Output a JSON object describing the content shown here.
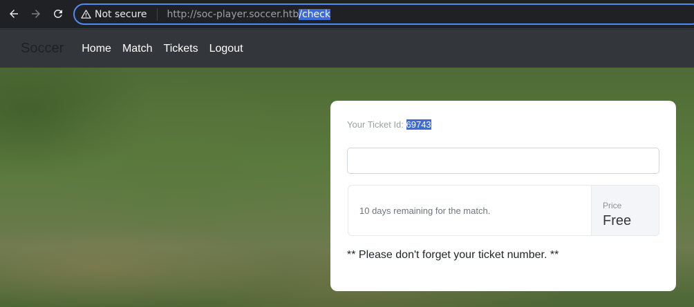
{
  "browser": {
    "security_label": "Not secure",
    "url_host": "http://soc-player.soccer.htb",
    "url_path": "/check"
  },
  "navbar": {
    "brand": "Soccer",
    "links": [
      "Home",
      "Match",
      "Tickets",
      "Logout"
    ]
  },
  "ticket": {
    "id_label": "Your Ticket Id: ",
    "id_value": "69743",
    "input_value": "",
    "input_placeholder": "",
    "remaining_text": "10 days remaining for the match.",
    "price_label": "Price",
    "price_value": "Free",
    "reminder": "** Please don't forget your ticket number. **"
  },
  "colors": {
    "accent": "#4f8cf6",
    "selection": "#3d6cd6",
    "navbar_bg": "#33373c"
  }
}
